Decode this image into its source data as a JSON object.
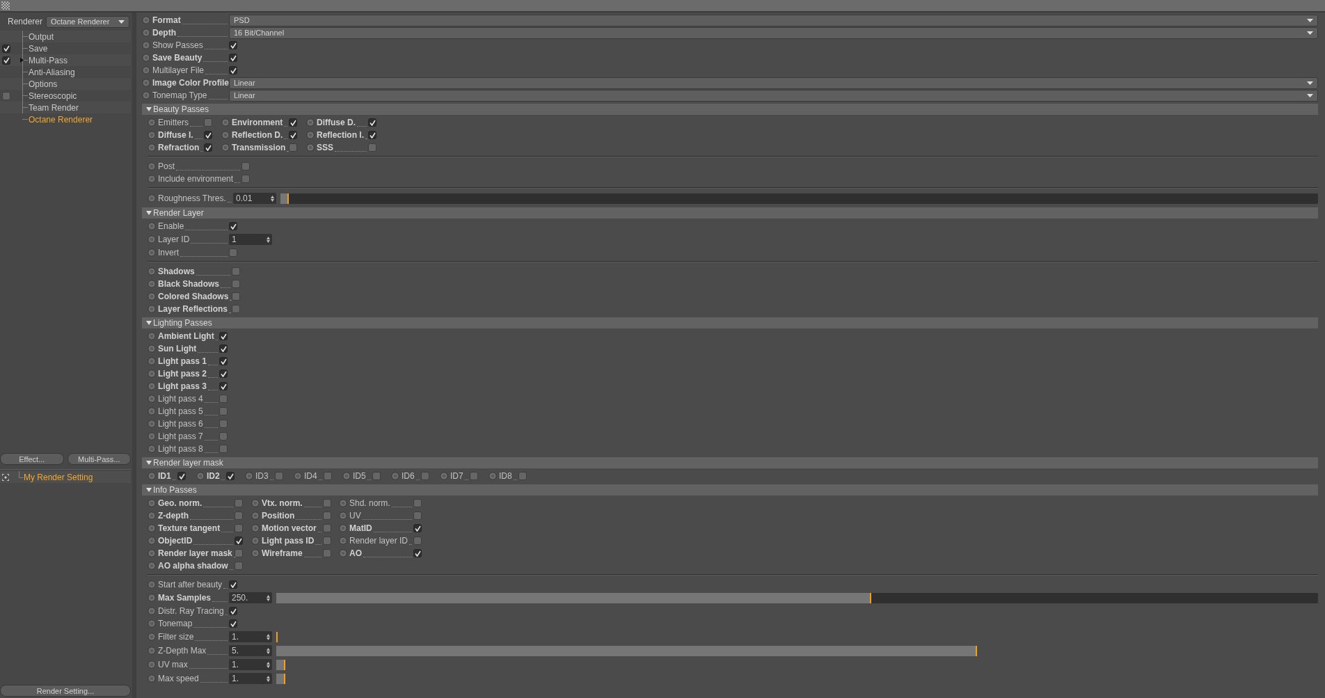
{
  "sidebar": {
    "renderer_label": "Renderer",
    "renderer_value": "Octane Renderer",
    "items": [
      {
        "label": "Output",
        "kind": "plain",
        "expandable": false,
        "selected": false
      },
      {
        "label": "Save",
        "kind": "checkbox",
        "checked": true,
        "expandable": false,
        "selected": false
      },
      {
        "label": "Multi-Pass",
        "kind": "checkbox",
        "checked": true,
        "expandable": true,
        "selected": false
      },
      {
        "label": "Anti-Aliasing",
        "kind": "plain",
        "expandable": false,
        "selected": false
      },
      {
        "label": "Options",
        "kind": "plain",
        "expandable": false,
        "selected": false
      },
      {
        "label": "Stereoscopic",
        "kind": "checkbox",
        "checked": false,
        "expandable": false,
        "selected": false
      },
      {
        "label": "Team Render",
        "kind": "plain",
        "expandable": false,
        "selected": false
      },
      {
        "label": "Octane Renderer",
        "kind": "plain",
        "expandable": false,
        "selected": true
      }
    ],
    "buttons": [
      "Effect...",
      "Multi-Pass..."
    ],
    "render_settings": [
      {
        "label": "My Render Setting",
        "selected": true
      }
    ],
    "footer_button": "Render Setting..."
  },
  "main": [
    {
      "kind": "fields",
      "rows": [
        {
          "label": "Format",
          "bold": true,
          "kind": "dropdown",
          "value": "PSD"
        },
        {
          "label": "Depth",
          "bold": true,
          "kind": "dropdown",
          "value": "16 Bit/Channel"
        },
        {
          "label": "Show Passes",
          "bold": false,
          "kind": "checkbox",
          "checked": true
        },
        {
          "label": "Save Beauty",
          "bold": true,
          "kind": "checkbox",
          "checked": true
        },
        {
          "label": "Multilayer File",
          "bold": false,
          "kind": "checkbox",
          "checked": true
        },
        {
          "label": "Image Color Profile",
          "bold": true,
          "kind": "dropdown",
          "value": "Linear"
        },
        {
          "label": "Tonemap Type",
          "bold": false,
          "kind": "dropdown",
          "value": "Linear"
        }
      ]
    },
    {
      "kind": "header",
      "label": "Beauty Passes",
      "expanded": true
    },
    {
      "kind": "grid",
      "rows": [
        [
          {
            "label": "Emitters",
            "bold": false,
            "checked": false
          },
          {
            "label": "Environment",
            "bold": true,
            "checked": true
          },
          {
            "label": "Diffuse D.",
            "bold": true,
            "checked": true
          }
        ],
        [
          {
            "label": "Diffuse I.",
            "bold": true,
            "checked": true
          },
          {
            "label": "Reflection D.",
            "bold": true,
            "checked": true
          },
          {
            "label": "Reflection I.",
            "bold": true,
            "checked": true
          }
        ],
        [
          {
            "label": "Refraction",
            "bold": true,
            "checked": true
          },
          {
            "label": "Transmission",
            "bold": true,
            "checked": false
          },
          {
            "label": "SSS",
            "bold": true,
            "checked": false
          }
        ]
      ]
    },
    {
      "kind": "divider"
    },
    {
      "kind": "fields",
      "rows": [
        {
          "label": "Post",
          "bold": false,
          "kind": "checkbox",
          "checked": false
        },
        {
          "label": "Include environment",
          "bold": false,
          "kind": "checkbox",
          "checked": false
        }
      ]
    },
    {
      "kind": "divider"
    },
    {
      "kind": "fields",
      "rows": [
        {
          "label": "Roughness Thres.",
          "bold": false,
          "kind": "slider",
          "value": "0.01",
          "level": 0.008,
          "track": true
        }
      ]
    },
    {
      "kind": "header",
      "label": "Render Layer",
      "expanded": true
    },
    {
      "kind": "fields",
      "rows": [
        {
          "label": "Enable",
          "bold": false,
          "kind": "checkbox",
          "checked": true
        },
        {
          "label": "Layer ID",
          "bold": false,
          "kind": "number",
          "value": "1"
        },
        {
          "label": "Invert",
          "bold": false,
          "kind": "checkbox",
          "checked": false
        }
      ]
    },
    {
      "kind": "divider"
    },
    {
      "kind": "fields",
      "rows": [
        {
          "label": "Shadows",
          "bold": true,
          "kind": "checkbox",
          "checked": false
        },
        {
          "label": "Black Shadows",
          "bold": true,
          "kind": "checkbox",
          "checked": false
        },
        {
          "label": "Colored Shadows",
          "bold": true,
          "kind": "checkbox",
          "checked": false
        },
        {
          "label": "Layer Reflections",
          "bold": true,
          "kind": "checkbox",
          "checked": false
        }
      ]
    },
    {
      "kind": "header",
      "label": "Lighting Passes",
      "expanded": true
    },
    {
      "kind": "fields",
      "rows": [
        {
          "label": "Ambient Light",
          "bold": true,
          "kind": "checkbox",
          "checked": true
        },
        {
          "label": "Sun Light",
          "bold": true,
          "kind": "checkbox",
          "checked": true
        },
        {
          "label": "Light pass 1",
          "bold": true,
          "kind": "checkbox",
          "checked": true
        },
        {
          "label": "Light pass 2",
          "bold": true,
          "kind": "checkbox",
          "checked": true
        },
        {
          "label": "Light pass 3",
          "bold": true,
          "kind": "checkbox",
          "checked": true
        },
        {
          "label": "Light pass 4",
          "bold": false,
          "kind": "checkbox",
          "checked": false
        },
        {
          "label": "Light pass 5",
          "bold": false,
          "kind": "checkbox",
          "checked": false
        },
        {
          "label": "Light pass 6",
          "bold": false,
          "kind": "checkbox",
          "checked": false
        },
        {
          "label": "Light pass 7",
          "bold": false,
          "kind": "checkbox",
          "checked": false
        },
        {
          "label": "Light pass 8",
          "bold": false,
          "kind": "checkbox",
          "checked": false
        }
      ]
    },
    {
      "kind": "header",
      "label": "Render layer mask",
      "expanded": true
    },
    {
      "kind": "grid",
      "rows": [
        [
          {
            "label": "ID1",
            "bold": true,
            "checked": true
          },
          {
            "label": "ID2",
            "bold": true,
            "checked": true
          },
          {
            "label": "ID3",
            "bold": false,
            "checked": false
          },
          {
            "label": "ID4",
            "bold": false,
            "checked": false
          },
          {
            "label": "ID5",
            "bold": false,
            "checked": false
          },
          {
            "label": "ID6",
            "bold": false,
            "checked": false
          },
          {
            "label": "ID7",
            "bold": false,
            "checked": false
          },
          {
            "label": "ID8",
            "bold": false,
            "checked": false
          }
        ]
      ]
    },
    {
      "kind": "header",
      "label": "Info Passes",
      "expanded": true
    },
    {
      "kind": "grid",
      "rows": [
        [
          {
            "label": "Geo. norm.",
            "bold": true,
            "checked": false
          },
          {
            "label": "Vtx. norm.",
            "bold": true,
            "checked": false
          },
          {
            "label": "Shd. norm.",
            "bold": false,
            "checked": false
          }
        ],
        [
          {
            "label": "Z-depth",
            "bold": true,
            "checked": false
          },
          {
            "label": "Position",
            "bold": true,
            "checked": false
          },
          {
            "label": "UV",
            "bold": false,
            "checked": false
          }
        ],
        [
          {
            "label": "Texture tangent",
            "bold": true,
            "checked": false
          },
          {
            "label": "Motion vector",
            "bold": true,
            "checked": false
          },
          {
            "label": "MatID",
            "bold": true,
            "checked": true
          }
        ],
        [
          {
            "label": "ObjectID",
            "bold": true,
            "checked": true
          },
          {
            "label": "Light pass ID",
            "bold": true,
            "checked": false
          },
          {
            "label": "Render layer ID",
            "bold": false,
            "checked": false
          }
        ],
        [
          {
            "label": "Render layer mask",
            "bold": true,
            "checked": false
          },
          {
            "label": "Wireframe",
            "bold": true,
            "checked": false
          },
          {
            "label": "AO",
            "bold": true,
            "checked": true
          }
        ],
        [
          {
            "label": "AO alpha shadow",
            "bold": true,
            "checked": false
          }
        ]
      ]
    },
    {
      "kind": "divider"
    },
    {
      "kind": "fields",
      "rows": [
        {
          "label": "Start after beauty",
          "bold": false,
          "kind": "checkbox",
          "checked": true
        },
        {
          "label": "Max Samples",
          "bold": true,
          "kind": "slider",
          "value": "250.",
          "level": 0.571,
          "track": true
        },
        {
          "label": "Distr. Ray Tracing",
          "bold": false,
          "kind": "checkbox",
          "checked": true
        },
        {
          "label": "Tonemap",
          "bold": false,
          "kind": "checkbox",
          "checked": true
        },
        {
          "label": "Filter size",
          "bold": false,
          "kind": "slider",
          "value": "1.",
          "level": 0,
          "track": false
        },
        {
          "label": "Z-Depth Max",
          "bold": false,
          "kind": "slider",
          "value": "5.",
          "level": 0.673,
          "track": false
        },
        {
          "label": "UV max",
          "bold": false,
          "kind": "slider",
          "value": "1.",
          "level": 0.009,
          "track": false
        },
        {
          "label": "Max speed",
          "bold": false,
          "kind": "slider",
          "value": "1.",
          "level": 0.009,
          "track": false
        }
      ]
    }
  ]
}
